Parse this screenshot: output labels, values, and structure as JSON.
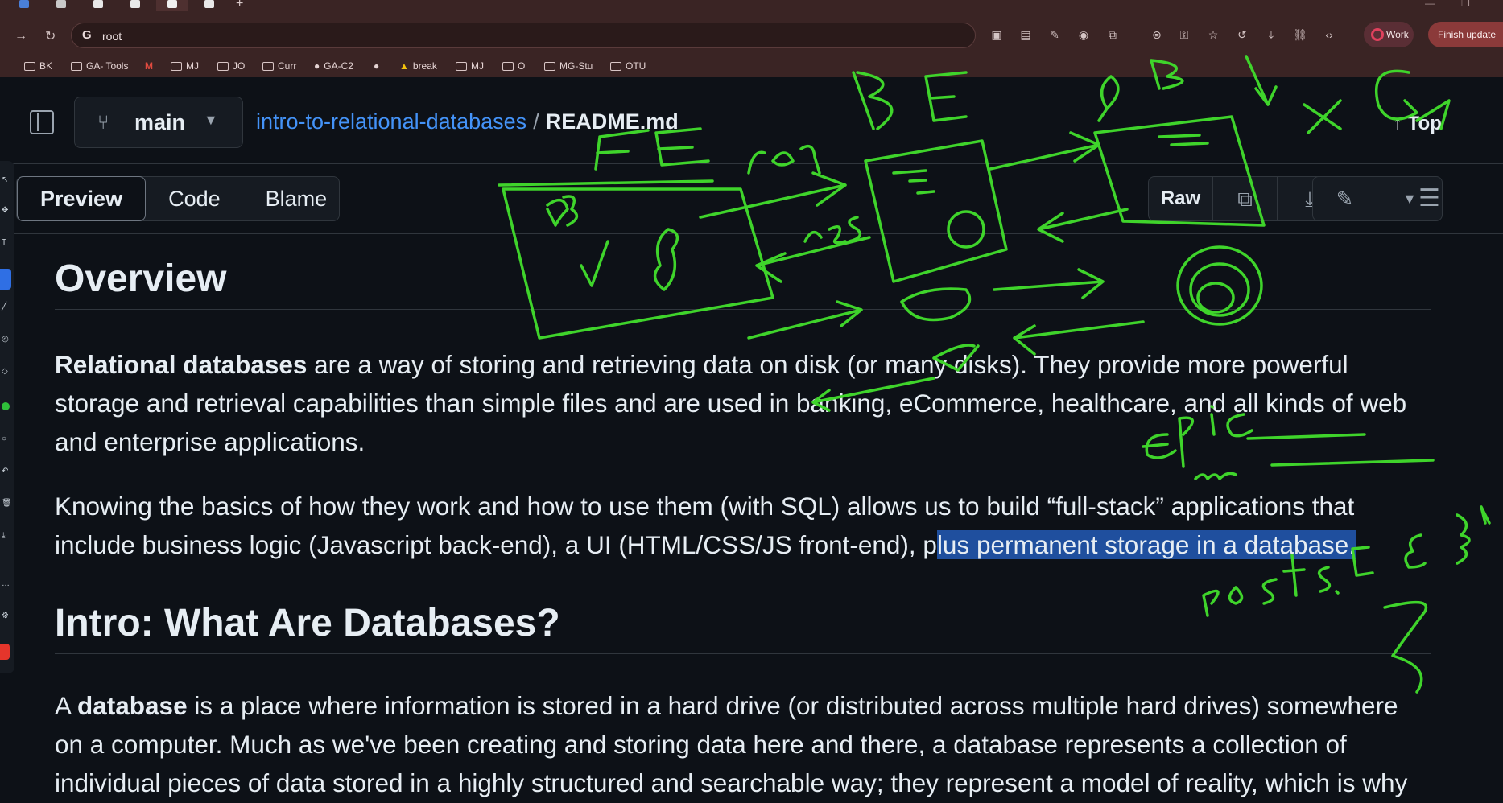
{
  "browser": {
    "address": "root",
    "profile_label": "Work",
    "update_label": "Finish update",
    "bookmarks": [
      "BK",
      "GA- Tools",
      "MJ",
      "JO",
      "Curr",
      "GA-C2",
      "break",
      "MJ",
      "O",
      "MG-Stu",
      "OTU"
    ]
  },
  "repo": {
    "branch": "main",
    "name": "intro-to-relational-databases",
    "separator": "/",
    "file": "README.md",
    "top_label": "Top"
  },
  "file_toolbar": {
    "tabs": [
      "Preview",
      "Code",
      "Blame"
    ],
    "raw_label": "Raw"
  },
  "readme": {
    "overview_heading": "Overview",
    "p1_bold": "Relational databases",
    "p1_rest": " are a way of storing and retrieving data on disk (or many disks). They provide more powerful storage and retrieval capabilities than simple files and are used in banking, eCommerce, healthcare, and all kinds of web and enterprise applications.",
    "p2_before": "Knowing the basics of how they work and how to use them (with SQL) allows us to build “full-stack” applications that include business logic (Javascript back-end), a UI (HTML/CSS/JS front-end), p",
    "p2_highlight": "lus permanent storage in a database.",
    "intro_heading": "Intro: What Are Databases?",
    "p3_start": "A ",
    "p3_bold": "database",
    "p3_rest": " is a place where information is stored in a hard drive (or distributed across multiple hard drives) somewhere on a computer. Much as we've been creating and storing data here and there, a database represents a collection of individual pieces of data stored in a highly structured and searchable way; they represent a model of reality, which is why"
  },
  "colors": {
    "ink": "#3fd42b",
    "highlight": "#1f4f9e",
    "link": "#4493f8"
  },
  "icons": [
    "sidebar-toggle-icon",
    "branch-icon",
    "chevron-down-icon",
    "arrow-up-icon",
    "copy-icon",
    "download-icon",
    "pencil-icon",
    "outline-list-icon"
  ]
}
